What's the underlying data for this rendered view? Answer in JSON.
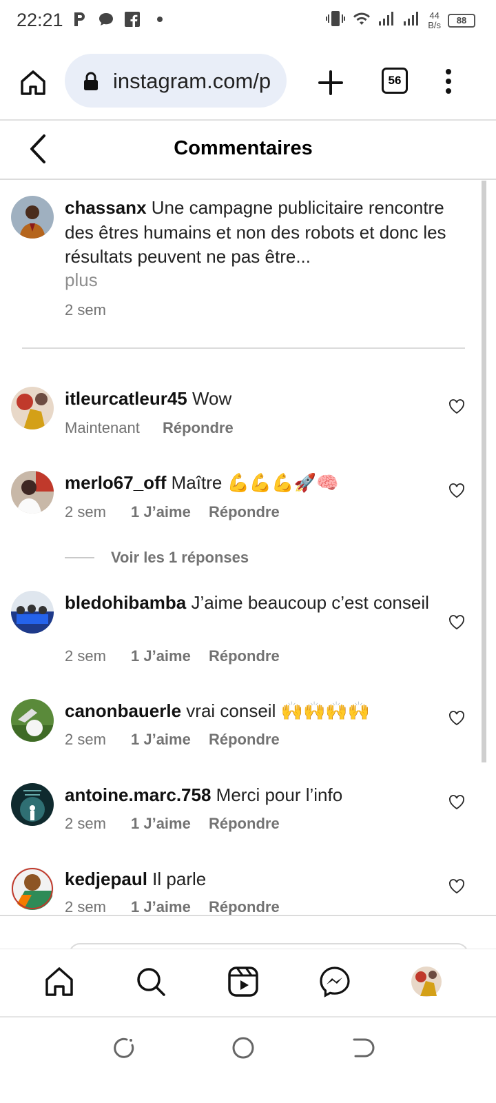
{
  "status_bar": {
    "time": "22:21",
    "net_speed_value": "44",
    "net_speed_unit": "B/s",
    "battery": "88"
  },
  "browser": {
    "url": "instagram.com/p",
    "tab_count": "56"
  },
  "header": {
    "title": "Commentaires"
  },
  "caption": {
    "username": "chassanx",
    "text": "Une campagne publicitaire rencontre des êtres humains et non des robots et donc les résultats peuvent ne pas être...",
    "more": "plus",
    "time": "2 sem"
  },
  "comments": [
    {
      "username": "itleurcatleur45",
      "text": "Wow",
      "time": "Maintenant",
      "likes": "",
      "reply": "Répondre"
    },
    {
      "username": "merlo67_off",
      "text": "Maître 💪💪💪🚀🧠",
      "time": "2 sem",
      "likes": "1 J’aime",
      "reply": "Répondre"
    },
    {
      "username": "bledohibamba",
      "text": "J’aime beaucoup c’est conseil",
      "time": "2 sem",
      "likes": "1 J’aime",
      "reply": "Répondre"
    },
    {
      "username": "canonbauerle",
      "text": "vrai conseil 🙌🙌🙌🙌",
      "time": "2 sem",
      "likes": "1 J’aime",
      "reply": "Répondre"
    },
    {
      "username": "antoine.marc.758",
      "text": "Merci pour l’info",
      "time": "2 sem",
      "likes": "1 J’aime",
      "reply": "Répondre"
    },
    {
      "username": "kedjepaul",
      "text": "Il parle",
      "time": "2 sem",
      "likes": "1 J’aime",
      "reply": "Répondre"
    }
  ],
  "view_replies": "Voir les 1 réponses",
  "icons": {
    "status_left": [
      "p-icon",
      "chat-bubble-icon",
      "facebook-icon",
      "dot-icon"
    ],
    "status_right": [
      "vibrate-icon",
      "wifi-icon",
      "signal-icon",
      "signal-icon",
      "battery-icon"
    ],
    "browser": [
      "home-icon",
      "lock-icon",
      "plus-icon",
      "tabs-icon",
      "kebab-menu-icon"
    ],
    "bottom_tabs": [
      "home-icon",
      "search-icon",
      "reels-icon",
      "messenger-icon",
      "profile-avatar"
    ],
    "system_nav": [
      "recents-icon",
      "home-circle-icon",
      "back-icon"
    ]
  },
  "colors": {
    "url_bar_bg": "#e9eef8",
    "secondary_text": "#737373",
    "divider": "#dbdbdb"
  }
}
